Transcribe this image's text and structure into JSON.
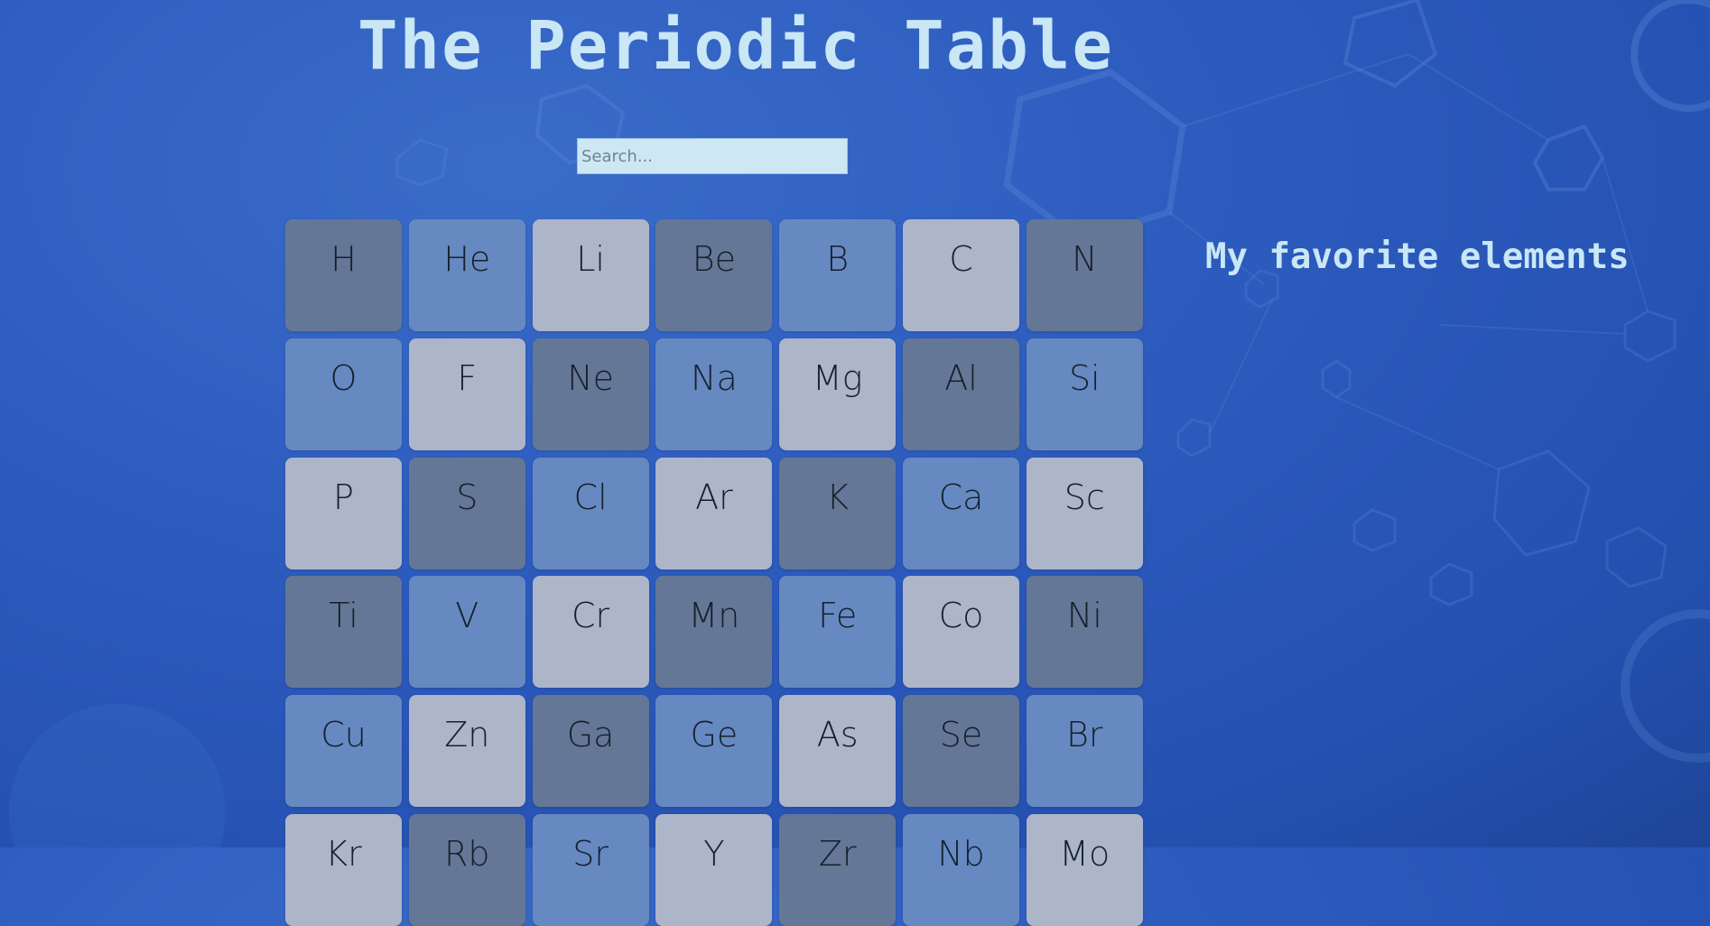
{
  "title": "The Periodic Table",
  "search": {
    "placeholder": "Search..."
  },
  "favorites": {
    "title": "My favorite elements"
  },
  "colors": {
    "dark": "#657796",
    "mid": "#6789c1",
    "light": "#adb5c9",
    "title": "#c9e7f5"
  },
  "elements": [
    {
      "symbol": "H",
      "shade": "dark"
    },
    {
      "symbol": "He",
      "shade": "mid"
    },
    {
      "symbol": "Li",
      "shade": "light"
    },
    {
      "symbol": "Be",
      "shade": "dark"
    },
    {
      "symbol": "B",
      "shade": "mid"
    },
    {
      "symbol": "C",
      "shade": "light"
    },
    {
      "symbol": "N",
      "shade": "dark"
    },
    {
      "symbol": "O",
      "shade": "mid"
    },
    {
      "symbol": "F",
      "shade": "light"
    },
    {
      "symbol": "Ne",
      "shade": "dark"
    },
    {
      "symbol": "Na",
      "shade": "mid"
    },
    {
      "symbol": "Mg",
      "shade": "light"
    },
    {
      "symbol": "Al",
      "shade": "dark"
    },
    {
      "symbol": "Si",
      "shade": "mid"
    },
    {
      "symbol": "P",
      "shade": "light"
    },
    {
      "symbol": "S",
      "shade": "dark"
    },
    {
      "symbol": "Cl",
      "shade": "mid"
    },
    {
      "symbol": "Ar",
      "shade": "light"
    },
    {
      "symbol": "K",
      "shade": "dark"
    },
    {
      "symbol": "Ca",
      "shade": "mid"
    },
    {
      "symbol": "Sc",
      "shade": "light"
    },
    {
      "symbol": "Ti",
      "shade": "dark"
    },
    {
      "symbol": "V",
      "shade": "mid"
    },
    {
      "symbol": "Cr",
      "shade": "light"
    },
    {
      "symbol": "Mn",
      "shade": "dark"
    },
    {
      "symbol": "Fe",
      "shade": "mid"
    },
    {
      "symbol": "Co",
      "shade": "light"
    },
    {
      "symbol": "Ni",
      "shade": "dark"
    },
    {
      "symbol": "Cu",
      "shade": "mid"
    },
    {
      "symbol": "Zn",
      "shade": "light"
    },
    {
      "symbol": "Ga",
      "shade": "dark"
    },
    {
      "symbol": "Ge",
      "shade": "mid"
    },
    {
      "symbol": "As",
      "shade": "light"
    },
    {
      "symbol": "Se",
      "shade": "dark"
    },
    {
      "symbol": "Br",
      "shade": "mid"
    },
    {
      "symbol": "Kr",
      "shade": "light"
    },
    {
      "symbol": "Rb",
      "shade": "dark"
    },
    {
      "symbol": "Sr",
      "shade": "mid"
    },
    {
      "symbol": "Y",
      "shade": "light"
    },
    {
      "symbol": "Zr",
      "shade": "dark"
    },
    {
      "symbol": "Nb",
      "shade": "mid"
    },
    {
      "symbol": "Mo",
      "shade": "light"
    }
  ]
}
